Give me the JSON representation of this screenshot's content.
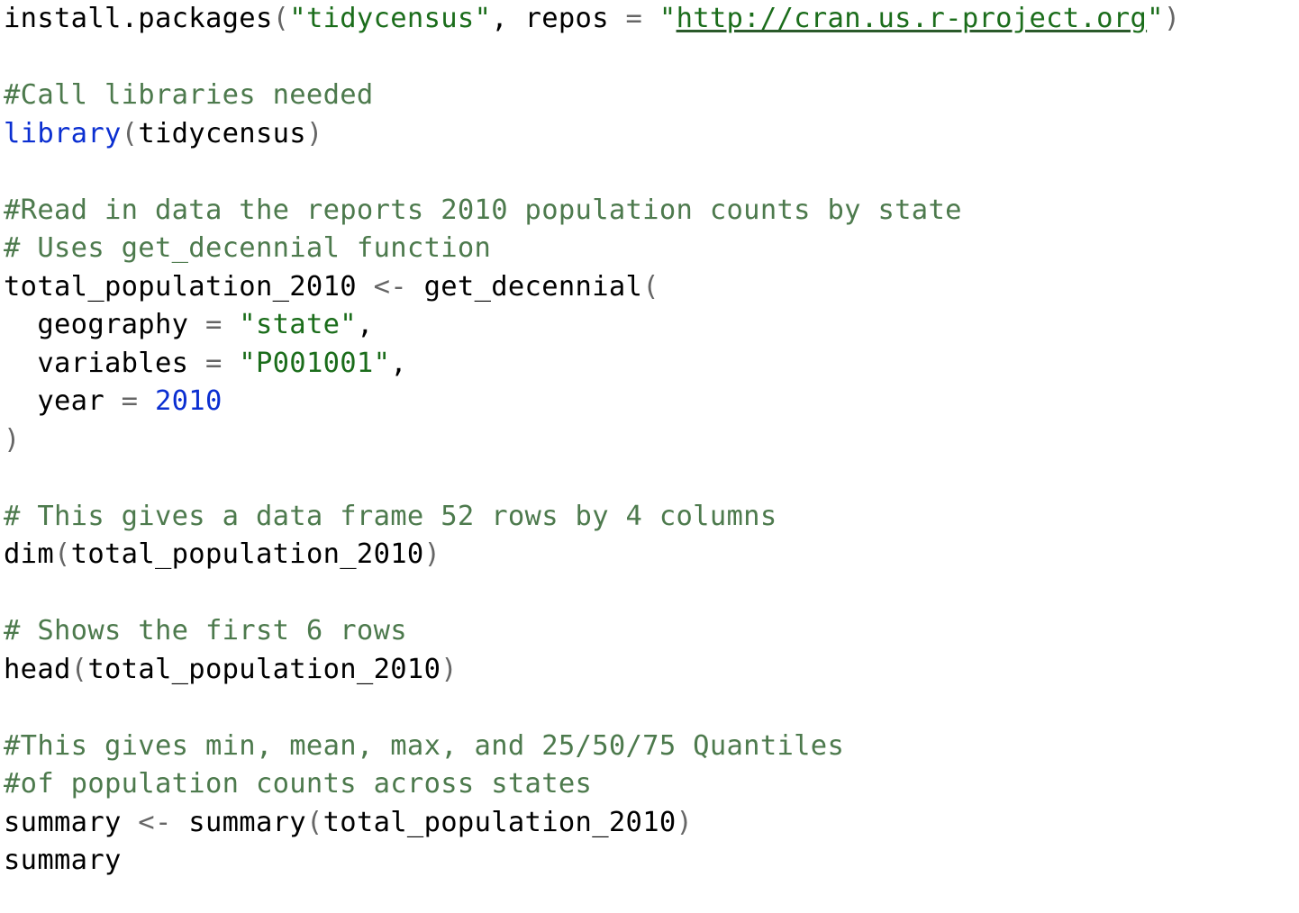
{
  "editor": {
    "lines": [
      {
        "tokens": [
          {
            "t": "install.packages",
            "c": "plain"
          },
          {
            "t": "(",
            "c": "punct"
          },
          {
            "t": "\"tidycensus\"",
            "c": "string"
          },
          {
            "t": ", ",
            "c": "plain"
          },
          {
            "t": "repos",
            "c": "plain"
          },
          {
            "t": " = ",
            "c": "op"
          },
          {
            "t": "\"",
            "c": "string"
          },
          {
            "t": "http://cran.us.r-project.org",
            "c": "string url"
          },
          {
            "t": "\"",
            "c": "string"
          },
          {
            "t": ")",
            "c": "punct"
          }
        ]
      },
      {
        "tokens": []
      },
      {
        "tokens": [
          {
            "t": "#Call libraries needed",
            "c": "comment"
          }
        ]
      },
      {
        "tokens": [
          {
            "t": "library",
            "c": "keyword"
          },
          {
            "t": "(",
            "c": "punct"
          },
          {
            "t": "tidycensus",
            "c": "plain"
          },
          {
            "t": ")",
            "c": "punct"
          }
        ]
      },
      {
        "tokens": []
      },
      {
        "tokens": [
          {
            "t": "#Read in data the reports 2010 population counts by state",
            "c": "comment"
          }
        ]
      },
      {
        "tokens": [
          {
            "t": "# Uses get_decennial function",
            "c": "comment"
          }
        ]
      },
      {
        "tokens": [
          {
            "t": "total_population_2010",
            "c": "plain"
          },
          {
            "t": " <- ",
            "c": "op"
          },
          {
            "t": "get_decennial",
            "c": "plain"
          },
          {
            "t": "(",
            "c": "punct"
          }
        ]
      },
      {
        "tokens": [
          {
            "t": "  geography",
            "c": "plain"
          },
          {
            "t": " = ",
            "c": "op"
          },
          {
            "t": "\"state\"",
            "c": "string"
          },
          {
            "t": ",",
            "c": "plain"
          }
        ]
      },
      {
        "tokens": [
          {
            "t": "  variables",
            "c": "plain"
          },
          {
            "t": " = ",
            "c": "op"
          },
          {
            "t": "\"P001001\"",
            "c": "string"
          },
          {
            "t": ",",
            "c": "plain"
          }
        ]
      },
      {
        "tokens": [
          {
            "t": "  year",
            "c": "plain"
          },
          {
            "t": " = ",
            "c": "op"
          },
          {
            "t": "2010",
            "c": "number"
          }
        ]
      },
      {
        "tokens": [
          {
            "t": ")",
            "c": "punct"
          }
        ]
      },
      {
        "tokens": []
      },
      {
        "tokens": [
          {
            "t": "# This gives a data frame 52 rows by 4 columns",
            "c": "comment"
          }
        ]
      },
      {
        "tokens": [
          {
            "t": "dim",
            "c": "plain"
          },
          {
            "t": "(",
            "c": "punct"
          },
          {
            "t": "total_population_2010",
            "c": "plain"
          },
          {
            "t": ")",
            "c": "punct"
          }
        ]
      },
      {
        "tokens": []
      },
      {
        "tokens": [
          {
            "t": "# Shows the first 6 rows",
            "c": "comment"
          }
        ]
      },
      {
        "tokens": [
          {
            "t": "head",
            "c": "plain"
          },
          {
            "t": "(",
            "c": "punct"
          },
          {
            "t": "total_population_2010",
            "c": "plain"
          },
          {
            "t": ")",
            "c": "punct"
          }
        ]
      },
      {
        "tokens": []
      },
      {
        "tokens": [
          {
            "t": "#This gives min, mean, max, and 25/50/75 Quantiles",
            "c": "comment"
          }
        ]
      },
      {
        "tokens": [
          {
            "t": "#of population counts across states",
            "c": "comment"
          }
        ]
      },
      {
        "tokens": [
          {
            "t": "summary",
            "c": "plain"
          },
          {
            "t": " <- ",
            "c": "op"
          },
          {
            "t": "summary",
            "c": "plain"
          },
          {
            "t": "(",
            "c": "punct"
          },
          {
            "t": "total_population_2010",
            "c": "plain"
          },
          {
            "t": ")",
            "c": "punct"
          }
        ]
      },
      {
        "tokens": [
          {
            "t": "summary",
            "c": "plain"
          }
        ]
      }
    ]
  }
}
